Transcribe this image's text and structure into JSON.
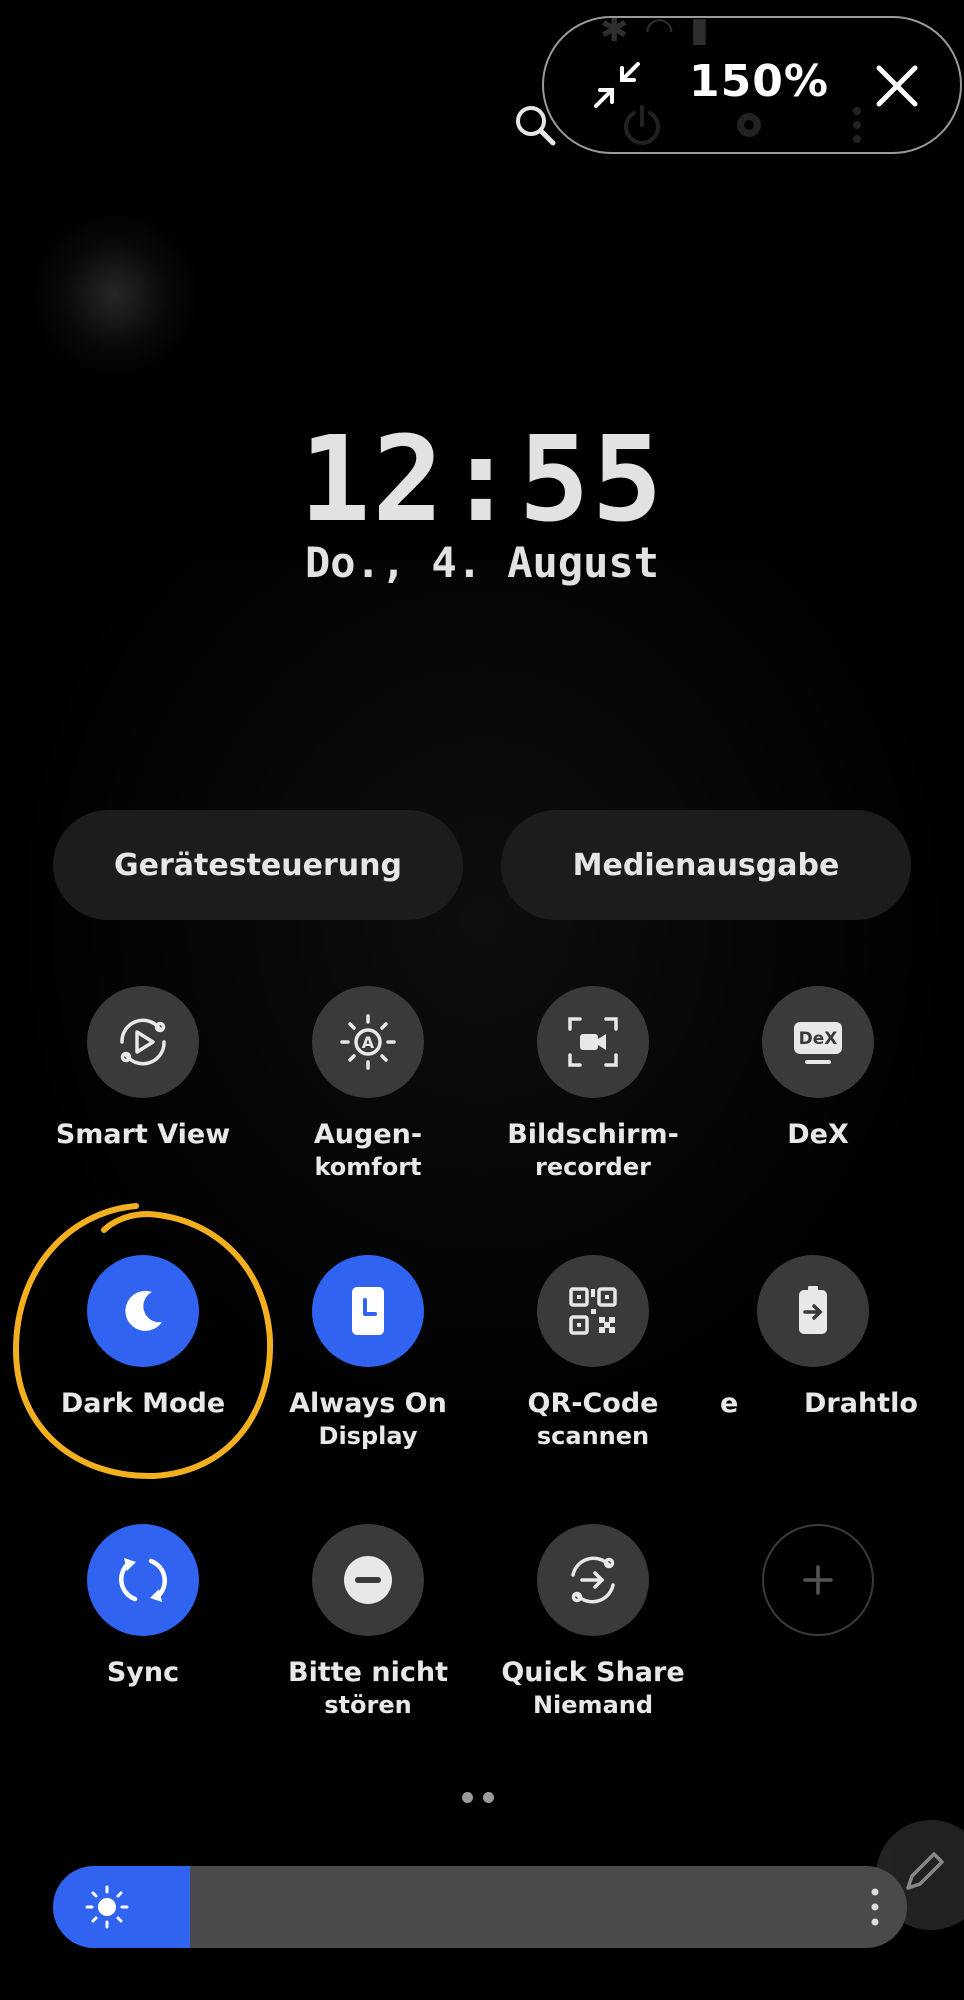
{
  "zoom": {
    "level": "150%"
  },
  "lockscreen": {
    "time": "12:55",
    "date": "Do., 4. August"
  },
  "quick_panel": {
    "device_control_label": "Gerätesteuerung",
    "media_output_label": "Medienausgabe",
    "tiles": [
      {
        "label": "Smart View",
        "sub": "",
        "icon": "smart-view-icon",
        "active": false
      },
      {
        "label": "Augen-",
        "sub": "komfort",
        "icon": "eye-comfort-icon",
        "active": false
      },
      {
        "label": "Bildschirm-",
        "sub": "recorder",
        "icon": "screen-recorder-icon",
        "active": false
      },
      {
        "label": "DeX",
        "sub": "",
        "icon": "dex-icon",
        "active": false
      },
      {
        "label": "Dark Mode",
        "sub": "",
        "icon": "moon-icon",
        "active": true
      },
      {
        "label": "Always On",
        "sub": "Display",
        "icon": "clock-icon",
        "active": true
      },
      {
        "label": "QR-Code",
        "sub": "scannen",
        "icon": "qr-code-icon",
        "active": false
      },
      {
        "label": "Drahtlo",
        "sub": "",
        "icon": "battery-share-icon",
        "active": false,
        "partial_prefix": "e"
      },
      {
        "label": "Sync",
        "sub": "",
        "icon": "sync-icon",
        "active": true
      },
      {
        "label": "Bitte nicht",
        "sub": "stören",
        "icon": "do-not-disturb-icon",
        "active": false
      },
      {
        "label": "Quick Share",
        "sub": "Niemand",
        "icon": "quick-share-icon",
        "active": false
      }
    ],
    "dex_text": "DeX"
  },
  "brightness": {
    "level": 0.16
  },
  "colors": {
    "accent": "#2f63f0",
    "tile_off": "#3a3a3c",
    "highlight": "#f2b021"
  }
}
